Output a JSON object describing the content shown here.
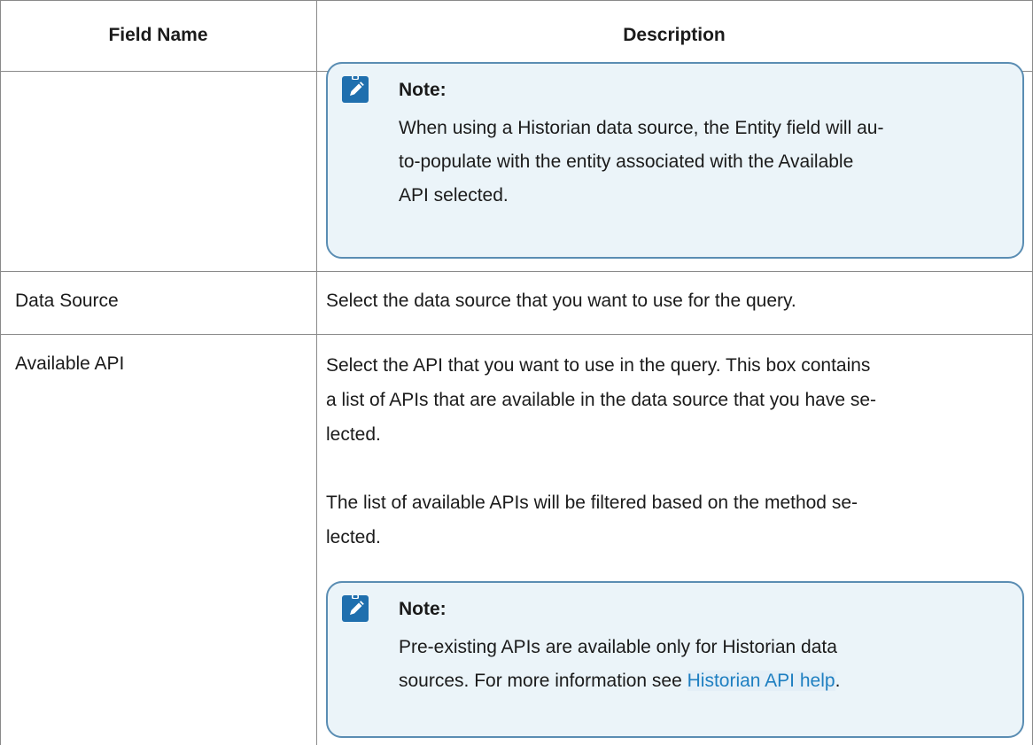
{
  "table": {
    "headers": {
      "field_name": "Field Name",
      "description": "Description"
    },
    "note_label": "Note:",
    "top_note": {
      "body": "When using a Historian data source, the Entity field will au-\nto-populate with the entity associated with the Available\nAPI selected."
    },
    "rows": [
      {
        "field": "Data Source",
        "description": "Select the data source that you want to use for the query."
      },
      {
        "field": "Available API",
        "description_p1": "Select the API that you want to use in the query. This box contains\na list of APIs that are available in the data source that you have se-\nlected.",
        "description_p2": "The list of available APIs will be filtered based on the method se-\nlected.",
        "note": {
          "body_before_link": "Pre-existing APIs are available only for Historian data\nsources. For more information see ",
          "link_text": "Historian API help",
          "body_after_link": "."
        }
      }
    ]
  },
  "colors": {
    "note_border": "#5a8db3",
    "note_bg": "#ebf4f9",
    "icon": "#1f6fae",
    "link": "#1e7fc1",
    "rule": "#8a8a8a"
  },
  "icons": {
    "note_icon": "pencil-clipboard-icon"
  }
}
